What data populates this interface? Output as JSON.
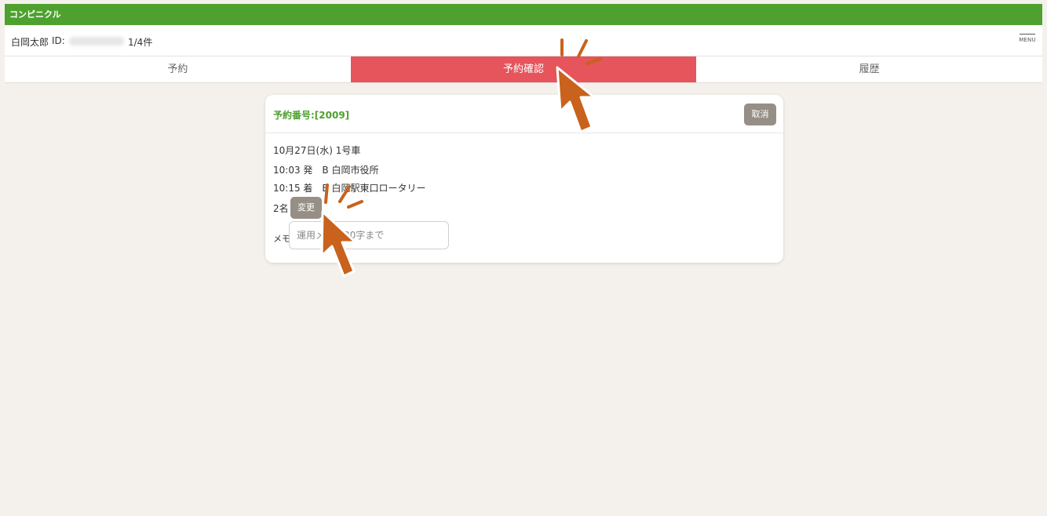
{
  "app": {
    "title": "コンピニクル"
  },
  "user": {
    "name": "白岡太郎",
    "id_label": "ID:",
    "count": "1/4件"
  },
  "menu": {
    "label": "MENU",
    "icon": "hamburger-menu-icon"
  },
  "tabs": [
    {
      "label": "予約"
    },
    {
      "label": "予約確認",
      "active": true
    },
    {
      "label": "履歴"
    }
  ],
  "reservation": {
    "number_label": "予約番号:[2009]",
    "cancel_label": "取消",
    "date_line": "10月27日(水) 1号車",
    "departure": "10:03 発　B 白岡市役所",
    "arrival": "10:15 着　B 白岡駅東口ロータリー",
    "passengers": "2名",
    "change_label": "変更",
    "memo_label": "メモ",
    "memo_placeholder": "運用メモ　20字まで"
  },
  "colors": {
    "brand_green": "#4ea12e",
    "active_tab": "#e5555b",
    "button_gray": "#958f86",
    "background": "#f4f1ec",
    "pointer_orange": "#c8621c"
  }
}
